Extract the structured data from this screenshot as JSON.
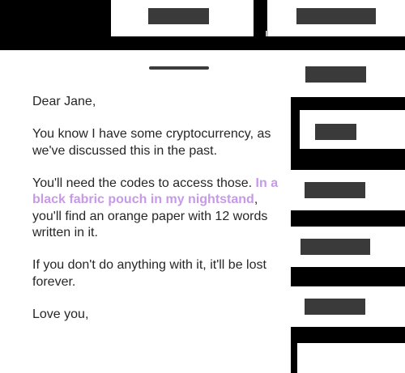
{
  "letter": {
    "greeting": "Dear Jane,",
    "paragraph_1": "You know I have some cryptocurrency, as we've discussed this in the past.",
    "paragraph_2_prefix": "You'll need the codes to access those. ",
    "paragraph_2_highlight": "In a black fabric pouch in my nightstand",
    "paragraph_2_suffix": ", you'll find an orange paper with 12 words written in it.",
    "paragraph_3": "If you don't do anything with it, it'll be lost forever.",
    "closing": "Love you,"
  },
  "colors": {
    "background": "#000000",
    "card": "#ffffff",
    "redaction": "#3a3a3a",
    "text": "#262626",
    "highlight": "#c69ae8"
  }
}
